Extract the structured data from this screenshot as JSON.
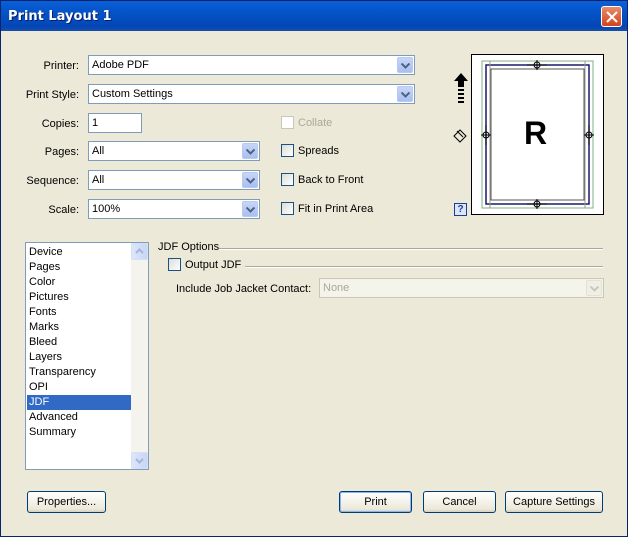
{
  "window": {
    "title": "Print Layout 1"
  },
  "printer": {
    "label": "Printer:",
    "value": "Adobe PDF"
  },
  "print_style": {
    "label": "Print Style:",
    "value": "Custom Settings"
  },
  "copies": {
    "label": "Copies:",
    "value": "1"
  },
  "pages": {
    "label": "Pages:",
    "value": "All"
  },
  "sequence": {
    "label": "Sequence:",
    "value": "All"
  },
  "scale": {
    "label": "Scale:",
    "value": "100%"
  },
  "options": {
    "collate": "Collate",
    "spreads": "Spreads",
    "back_to_front": "Back to Front",
    "fit_in_print_area": "Fit in Print Area"
  },
  "preview": {
    "letter": "R",
    "help": "?"
  },
  "categories": [
    "Device",
    "Pages",
    "Color",
    "Pictures",
    "Fonts",
    "Marks",
    "Bleed",
    "Layers",
    "Transparency",
    "OPI",
    "JDF",
    "Advanced",
    "Summary"
  ],
  "selected_category": "JDF",
  "jdf": {
    "section_title": "JDF Options",
    "output_jdf": "Output JDF",
    "job_jacket_label": "Include Job Jacket Contact:",
    "job_jacket_value": "None"
  },
  "buttons": {
    "properties": "Properties...",
    "print": "Print",
    "cancel": "Cancel",
    "capture_settings": "Capture Settings"
  }
}
